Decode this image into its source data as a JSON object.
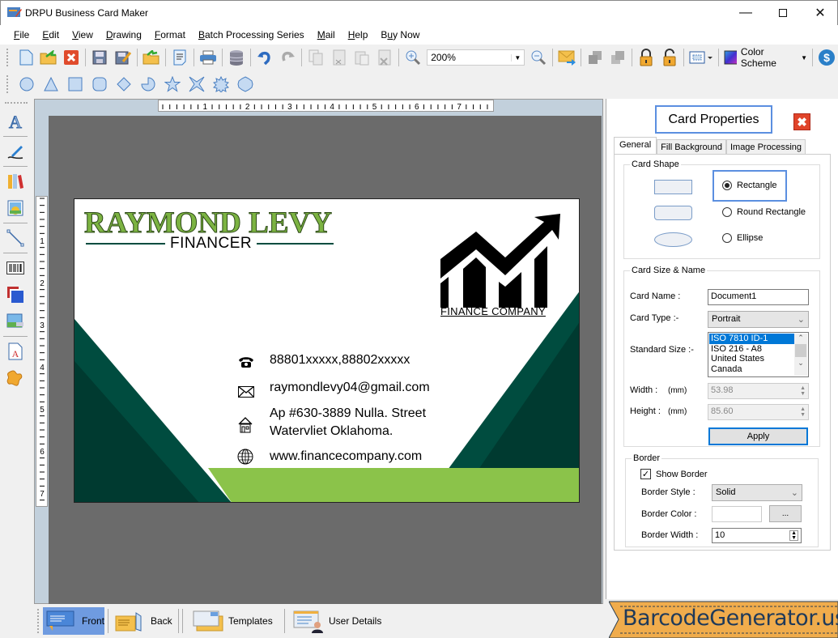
{
  "window": {
    "title": "DRPU Business Card Maker"
  },
  "menu": [
    {
      "label": "File",
      "u": "F",
      "rest": "ile"
    },
    {
      "label": "Edit",
      "u": "E",
      "rest": "dit"
    },
    {
      "label": "View",
      "u": "V",
      "rest": "iew"
    },
    {
      "label": "Drawing",
      "u": "D",
      "rest": "rawing"
    },
    {
      "label": "Format",
      "u": "F",
      "rest": "ormat"
    },
    {
      "label": "Batch Processing Series",
      "u": "B",
      "rest": "atch Processing Series"
    },
    {
      "label": "Mail",
      "u": "M",
      "rest": "ail"
    },
    {
      "label": "Help",
      "u": "H",
      "rest": "elp"
    },
    {
      "label": "Buy Now",
      "pre": "B",
      "u": "u",
      "rest": "y Now"
    }
  ],
  "toolbar": {
    "zoom_value": "200%",
    "color_scheme_label": "Color Scheme",
    "icons": [
      "new-icon",
      "open-icon",
      "close-doc-icon",
      "save-icon",
      "save-as-icon",
      "export-icon",
      "properties-icon",
      "print-icon",
      "database-icon",
      "undo-icon",
      "redo-icon",
      "copy-icon",
      "cut-icon",
      "paste-icon",
      "delete-icon",
      "zoom-in-icon",
      "zoom-out-icon",
      "mail-icon",
      "bring-front-icon",
      "send-back-icon",
      "lock-icon",
      "unlock-icon",
      "align-icon",
      "color-scheme-icon",
      "buy-icon"
    ]
  },
  "shapes_toolbar": [
    "circle",
    "triangle",
    "square",
    "rounded-square",
    "diamond",
    "pie",
    "star",
    "four-point-star",
    "burst",
    "polygon"
  ],
  "left_tools": [
    "text-tool",
    "signature-tool",
    "library-tool",
    "image-tool",
    "line-tool",
    "barcode-tool",
    "background-tool",
    "picture-tool",
    "watermark-tool",
    "shape-tool"
  ],
  "rulers": {
    "horizontal": [
      "1",
      "2",
      "3",
      "4",
      "5",
      "6",
      "7"
    ],
    "vertical": [
      "1",
      "2",
      "3",
      "4",
      "5",
      "6",
      "7"
    ]
  },
  "card": {
    "name": "RAYMOND LEVY",
    "title": "FINANCER",
    "company": "FINANCE COMPANY",
    "phone": "88801xxxxx,88802xxxxx",
    "email": "raymondlevy04@gmail.com",
    "address_line1": "Ap #630-3889 Nulla. Street",
    "address_line2": "Watervliet Oklahoma.",
    "website": "www.financecompany.com",
    "colors": {
      "dark_green": "#004c3f",
      "darker_green": "#003a30",
      "light_green": "#8bc34a",
      "name_green": "#7cb342"
    }
  },
  "properties": {
    "header": "Card Properties",
    "tabs": [
      "General",
      "Fill Background",
      "Image Processing"
    ],
    "active_tab": "General",
    "card_shape": {
      "label": "Card Shape",
      "options": [
        "Rectangle",
        "Round Rectangle",
        "Ellipse"
      ],
      "selected": "Rectangle"
    },
    "size_name": {
      "label": "Card Size & Name",
      "card_name_label": "Card Name :",
      "card_name_value": "Document1",
      "card_type_label": "Card Type :-",
      "card_type_value": "Portrait",
      "standard_size_label": "Standard Size :-",
      "standard_sizes": [
        "ISO 7810 ID-1",
        "ISO 216 - A8",
        "United States",
        "Canada"
      ],
      "standard_selected": "ISO 7810 ID-1",
      "width_label": "Width :",
      "height_label": "Height :",
      "unit": "(mm)",
      "width_value": "53.98",
      "height_value": "85.60",
      "apply_label": "Apply"
    },
    "border": {
      "label": "Border",
      "show_border_label": "Show Border",
      "show_border": true,
      "style_label": "Border Style :",
      "style_value": "Solid",
      "color_label": "Border Color :",
      "color_btn": "...",
      "width_label": "Border Width :",
      "width_value": "10"
    }
  },
  "bottom_tabs": [
    {
      "label": "Front",
      "active": true
    },
    {
      "label": "Back",
      "active": false
    },
    {
      "label": "Templates",
      "active": false
    },
    {
      "label": "User Details",
      "active": false
    }
  ],
  "brand": "BarcodeGenerator.us"
}
